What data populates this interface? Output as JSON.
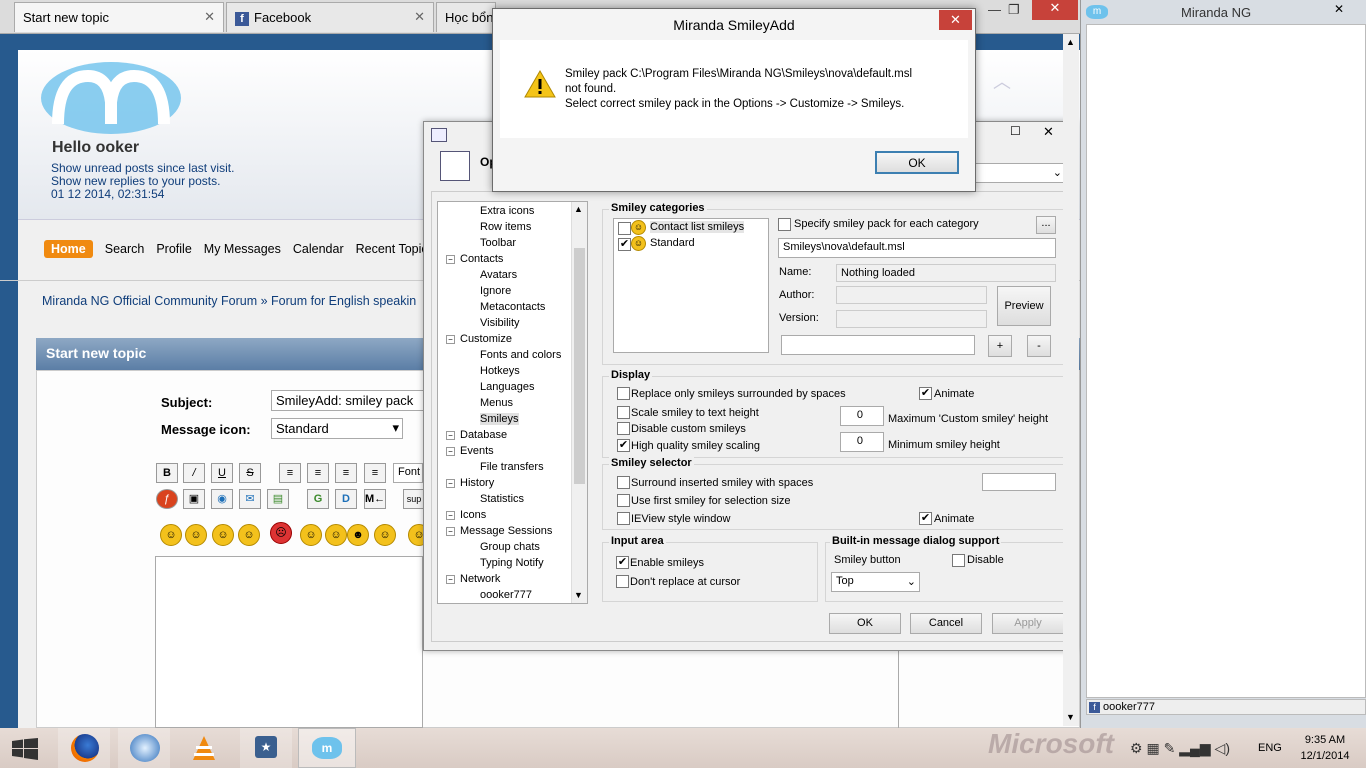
{
  "browser": {
    "tabs": [
      {
        "label": "Start new topic"
      },
      {
        "label": "Facebook"
      },
      {
        "label": "Học bổng"
      }
    ]
  },
  "forum": {
    "greeting": "Hello ooker",
    "links": [
      "Show unread posts since last visit.",
      "Show new replies to your posts."
    ],
    "datetime": "01 12 2014, 02:31:54",
    "nav": [
      "Home",
      "Search",
      "Profile",
      "My Messages",
      "Calendar",
      "Recent Topic"
    ],
    "breadcrumb": [
      "Miranda NG Official Community Forum",
      "»",
      "Forum for English speakin"
    ],
    "section_title": "Start new topic",
    "subject_label": "Subject:",
    "subject_value": "SmileyAdd: smiley pack",
    "icon_label": "Message icon:",
    "icon_value": "Standard",
    "font_label": "Font",
    "sup_label": "sup",
    "toolbar": {
      "bold": "B",
      "underline": "U",
      "strike": "S",
      "g": "G",
      "m": "M←"
    }
  },
  "msgbox": {
    "title": "Miranda SmileyAdd",
    "line1": "Smiley pack C:\\Program Files\\Miranda NG\\Smileys\\nova\\default.msl",
    "line2": "not found.",
    "line3": "Select correct smiley pack in the Options -> Customize -> Smileys.",
    "ok": "OK"
  },
  "options": {
    "title_partial": "Op",
    "tree": [
      {
        "label": "Extra icons",
        "level": 2
      },
      {
        "label": "Row items",
        "level": 2
      },
      {
        "label": "Toolbar",
        "level": 2
      },
      {
        "label": "Contacts",
        "level": 1
      },
      {
        "label": "Avatars",
        "level": 2
      },
      {
        "label": "Ignore",
        "level": 2
      },
      {
        "label": "Metacontacts",
        "level": 2
      },
      {
        "label": "Visibility",
        "level": 2
      },
      {
        "label": "Customize",
        "level": 1
      },
      {
        "label": "Fonts and colors",
        "level": 2
      },
      {
        "label": "Hotkeys",
        "level": 2
      },
      {
        "label": "Languages",
        "level": 2
      },
      {
        "label": "Menus",
        "level": 2
      },
      {
        "label": "Smileys",
        "level": 2
      },
      {
        "label": "Database",
        "level": 1
      },
      {
        "label": "Events",
        "level": 1
      },
      {
        "label": "File transfers",
        "level": 2
      },
      {
        "label": "History",
        "level": 1
      },
      {
        "label": "Statistics",
        "level": 2
      },
      {
        "label": "Icons",
        "level": 1
      },
      {
        "label": "Message Sessions",
        "level": 1
      },
      {
        "label": "Group chats",
        "level": 2
      },
      {
        "label": "Typing Notify",
        "level": 2
      },
      {
        "label": "Network",
        "level": 1
      },
      {
        "label": "oooker777",
        "level": 2
      }
    ],
    "smiley_categories": {
      "title": "Smiley categories",
      "items": [
        "Contact list smileys",
        "Standard"
      ],
      "specify_label": "Specify smiley pack for each category",
      "browse": "...",
      "pack_path": "Smileys\\nova\\default.msl",
      "name_label": "Name:",
      "name_value": "Nothing loaded",
      "author_label": "Author:",
      "version_label": "Version:",
      "preview": "Preview",
      "plus": "+",
      "minus": "-"
    },
    "display": {
      "title": "Display",
      "replace_only": "Replace only smileys surrounded by spaces",
      "animate": "Animate",
      "scale": "Scale smiley to text height",
      "disable_custom": "Disable custom smileys",
      "high_quality": "High quality smiley scaling",
      "max_value": "0",
      "max_label": "Maximum 'Custom smiley' height",
      "min_value": "0",
      "min_label": "Minimum smiley height"
    },
    "selector": {
      "title": "Smiley selector",
      "surround": "Surround inserted smiley with spaces",
      "first": "Use first smiley for selection size",
      "ieview": "IEView style window",
      "animate": "Animate"
    },
    "input": {
      "title": "Input area",
      "enable": "Enable smileys",
      "dont_replace": "Don't replace at cursor"
    },
    "builtin": {
      "title": "Built-in message dialog support",
      "smiley_button": "Smiley button",
      "disable": "Disable",
      "position": "Top"
    },
    "buttons": {
      "ok": "OK",
      "cancel": "Cancel",
      "apply": "Apply"
    }
  },
  "miranda": {
    "title": "Miranda NG",
    "account": "oooker777"
  },
  "taskbar": {
    "brand": "Microsoft",
    "lang": "ENG",
    "time": "9:35 AM",
    "date": "12/1/2014"
  },
  "colors": {
    "accent_orange": "#f08a10",
    "title_blue": "#275a8e",
    "close_red": "#c7423a"
  }
}
